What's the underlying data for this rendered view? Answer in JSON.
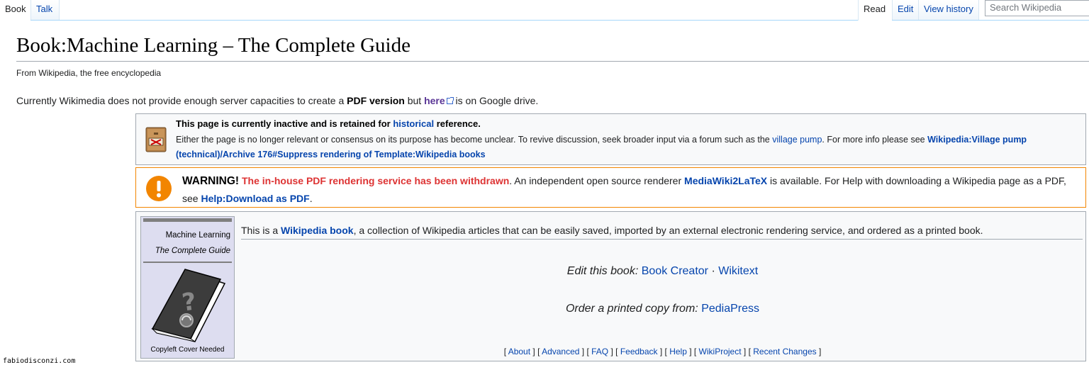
{
  "tabs": {
    "book": "Book",
    "talk": "Talk",
    "read": "Read",
    "edit": "Edit",
    "history": "View history"
  },
  "search": {
    "placeholder": "Search Wikipedia"
  },
  "page": {
    "title": "Book:Machine Learning – The Complete Guide",
    "subtitle": "From Wikipedia, the free encyclopedia"
  },
  "intro": {
    "t1": "Currently Wikimedia does not provide enough server capacities to create a ",
    "pdf": "PDF version",
    "t2": " but ",
    "here": "here",
    "t3": " is on Google drive."
  },
  "inactive_box": {
    "title_a": "This page is currently inactive and is retained for ",
    "title_link": "historical",
    "title_b": " reference.",
    "text_a": "Either the page is no longer relevant or consensus on its purpose has become unclear. To revive discussion, seek broader input via a forum such as the ",
    "village_pump": "village pump",
    "text_b": ". For more info please see ",
    "archive_link": "Wikipedia:Village pump (technical)/Archive 176#Suppress rendering of Template:Wikipedia books"
  },
  "warning_box": {
    "warning": "WARNING!",
    "red": "The in-house PDF rendering service has been withdrawn",
    "t1": ". An independent open source renderer ",
    "renderer": "MediaWiki2LaTeX",
    "t2": " is available. For Help with downloading a Wikipedia page as a PDF, see ",
    "help": "Help:Download as PDF",
    "t3": "."
  },
  "book_box": {
    "cover_title": "Machine Learning",
    "cover_subtitle": "The Complete Guide",
    "cover_caption": "Copyleft Cover Needed",
    "text_a": "This is a ",
    "wikibook": "Wikipedia book",
    "text_b": ", a collection of Wikipedia articles that can be easily saved, imported by an external electronic rendering service, and ordered as a printed book.",
    "edit_label": "Edit this book:",
    "book_creator": "Book Creator",
    "sep": "·",
    "wikitext": "Wikitext",
    "order_label": "Order a printed copy from:",
    "pediapress": "PediaPress",
    "links": [
      "About",
      "Advanced",
      "FAQ",
      "Feedback",
      "Help",
      "WikiProject",
      "Recent Changes"
    ]
  },
  "watermark": "fabiodisconzi.com",
  "icons": {
    "external": "external-link-icon",
    "inactive": "file-cabinet-icon",
    "warning": "warning-icon",
    "book": "book-icon"
  },
  "colors": {
    "link": "#0645ad",
    "visited": "#5a3696",
    "warning_border": "#f28500",
    "warning_red": "#d33",
    "cover_bg": "#ddddf0"
  }
}
